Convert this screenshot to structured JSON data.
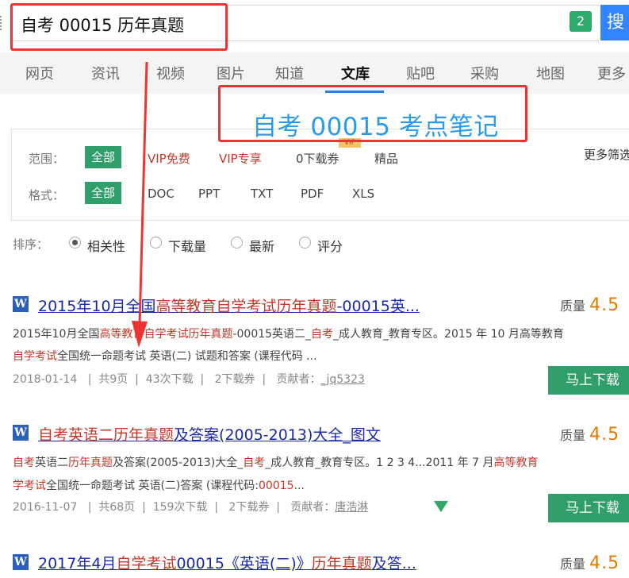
{
  "search": {
    "query": "自考 00015 历年真题",
    "voice_badge": "2",
    "button_label": "搜"
  },
  "nav": {
    "tabs": [
      "网页",
      "资讯",
      "视频",
      "图片",
      "知道",
      "文库",
      "贴吧",
      "采购",
      "地图",
      "更多"
    ],
    "active": "文库"
  },
  "annotation": {
    "text": "自考 00015  考点笔记",
    "color": "#2b9be8"
  },
  "filters": {
    "scope_label": "范围：",
    "scope_options": [
      "全部",
      "VIP免费",
      "VIP专享",
      "0下载券",
      "精品"
    ],
    "vip_tag": "VIP",
    "format_label": "格式：",
    "format_options": [
      "全部",
      "DOC",
      "PPT",
      "TXT",
      "PDF",
      "XLS"
    ],
    "more": "更多筛选"
  },
  "sort": {
    "label": "排序：",
    "options": [
      "相关性",
      "下载量",
      "最新",
      "评分"
    ],
    "selected": "相关性"
  },
  "results": [
    {
      "title_parts": [
        [
          "2015年10月全国",
          ""
        ],
        [
          "高等教育自学考试历年真题",
          "hl"
        ],
        [
          "-00015英...",
          ""
        ]
      ],
      "quality_label": "质量",
      "quality_score": "4.5",
      "snippet1": [
        [
          "2015年10月全国",
          ""
        ],
        [
          "高等教育自学考试历年真题",
          "hl"
        ],
        [
          "-00015",
          ""
        ],
        [
          "英语二_",
          ""
        ],
        [
          "自考",
          "hl"
        ],
        [
          "_成人教育_教育专区。2015 年 10 月",
          ""
        ],
        [
          "高等教育",
          ""
        ]
      ],
      "snippet2": [
        [
          "自学考试",
          "hl"
        ],
        [
          "全国统一命题考试 英语(二) 试题和答案 (课程代码 ...",
          ""
        ]
      ],
      "date": "2018-01-14",
      "pages": "共9页",
      "downloads": "43次下载",
      "coupons": "2下载券",
      "contributor_label": "贡献者：",
      "contributor": "_jq5323",
      "button": "马上下载"
    },
    {
      "title_parts": [
        [
          "自考英语二",
          "hl"
        ],
        [
          "历年真题",
          "hl"
        ],
        [
          "及答案(2005-2013)大全_图文",
          ""
        ]
      ],
      "quality_label": "质量",
      "quality_score": "4.5",
      "snippet1": [
        [
          "自考",
          "hl"
        ],
        [
          "英语二",
          ""
        ],
        [
          "历年真题",
          "hl"
        ],
        [
          "及答案(2005-2013)大全_",
          ""
        ],
        [
          "自考",
          "hl"
        ],
        [
          "_成人教育_教育专区。1 2 3 4...2011 年 7 月",
          ""
        ],
        [
          "高等教育",
          "hl"
        ]
      ],
      "snippet2": [
        [
          "学考试",
          "hl"
        ],
        [
          "全国统一命题考试 英语(二)答案 (课程代码:",
          ""
        ],
        [
          "00015",
          "hl"
        ],
        [
          "...",
          ""
        ]
      ],
      "date": "2016-11-07",
      "pages": "共68页",
      "downloads": "159次下载",
      "coupons": "2下载券",
      "contributor_label": "贡献者：",
      "contributor": "唐浩淋",
      "button": "马上下载"
    },
    {
      "title_parts": [
        [
          "2017年4月",
          ""
        ],
        [
          "自学考试",
          "hl"
        ],
        [
          "00015《英语(二)》",
          ""
        ],
        [
          "历年真题",
          "hl"
        ],
        [
          "及答...",
          ""
        ]
      ],
      "quality_label": "质量",
      "quality_score": "4.5"
    }
  ]
}
